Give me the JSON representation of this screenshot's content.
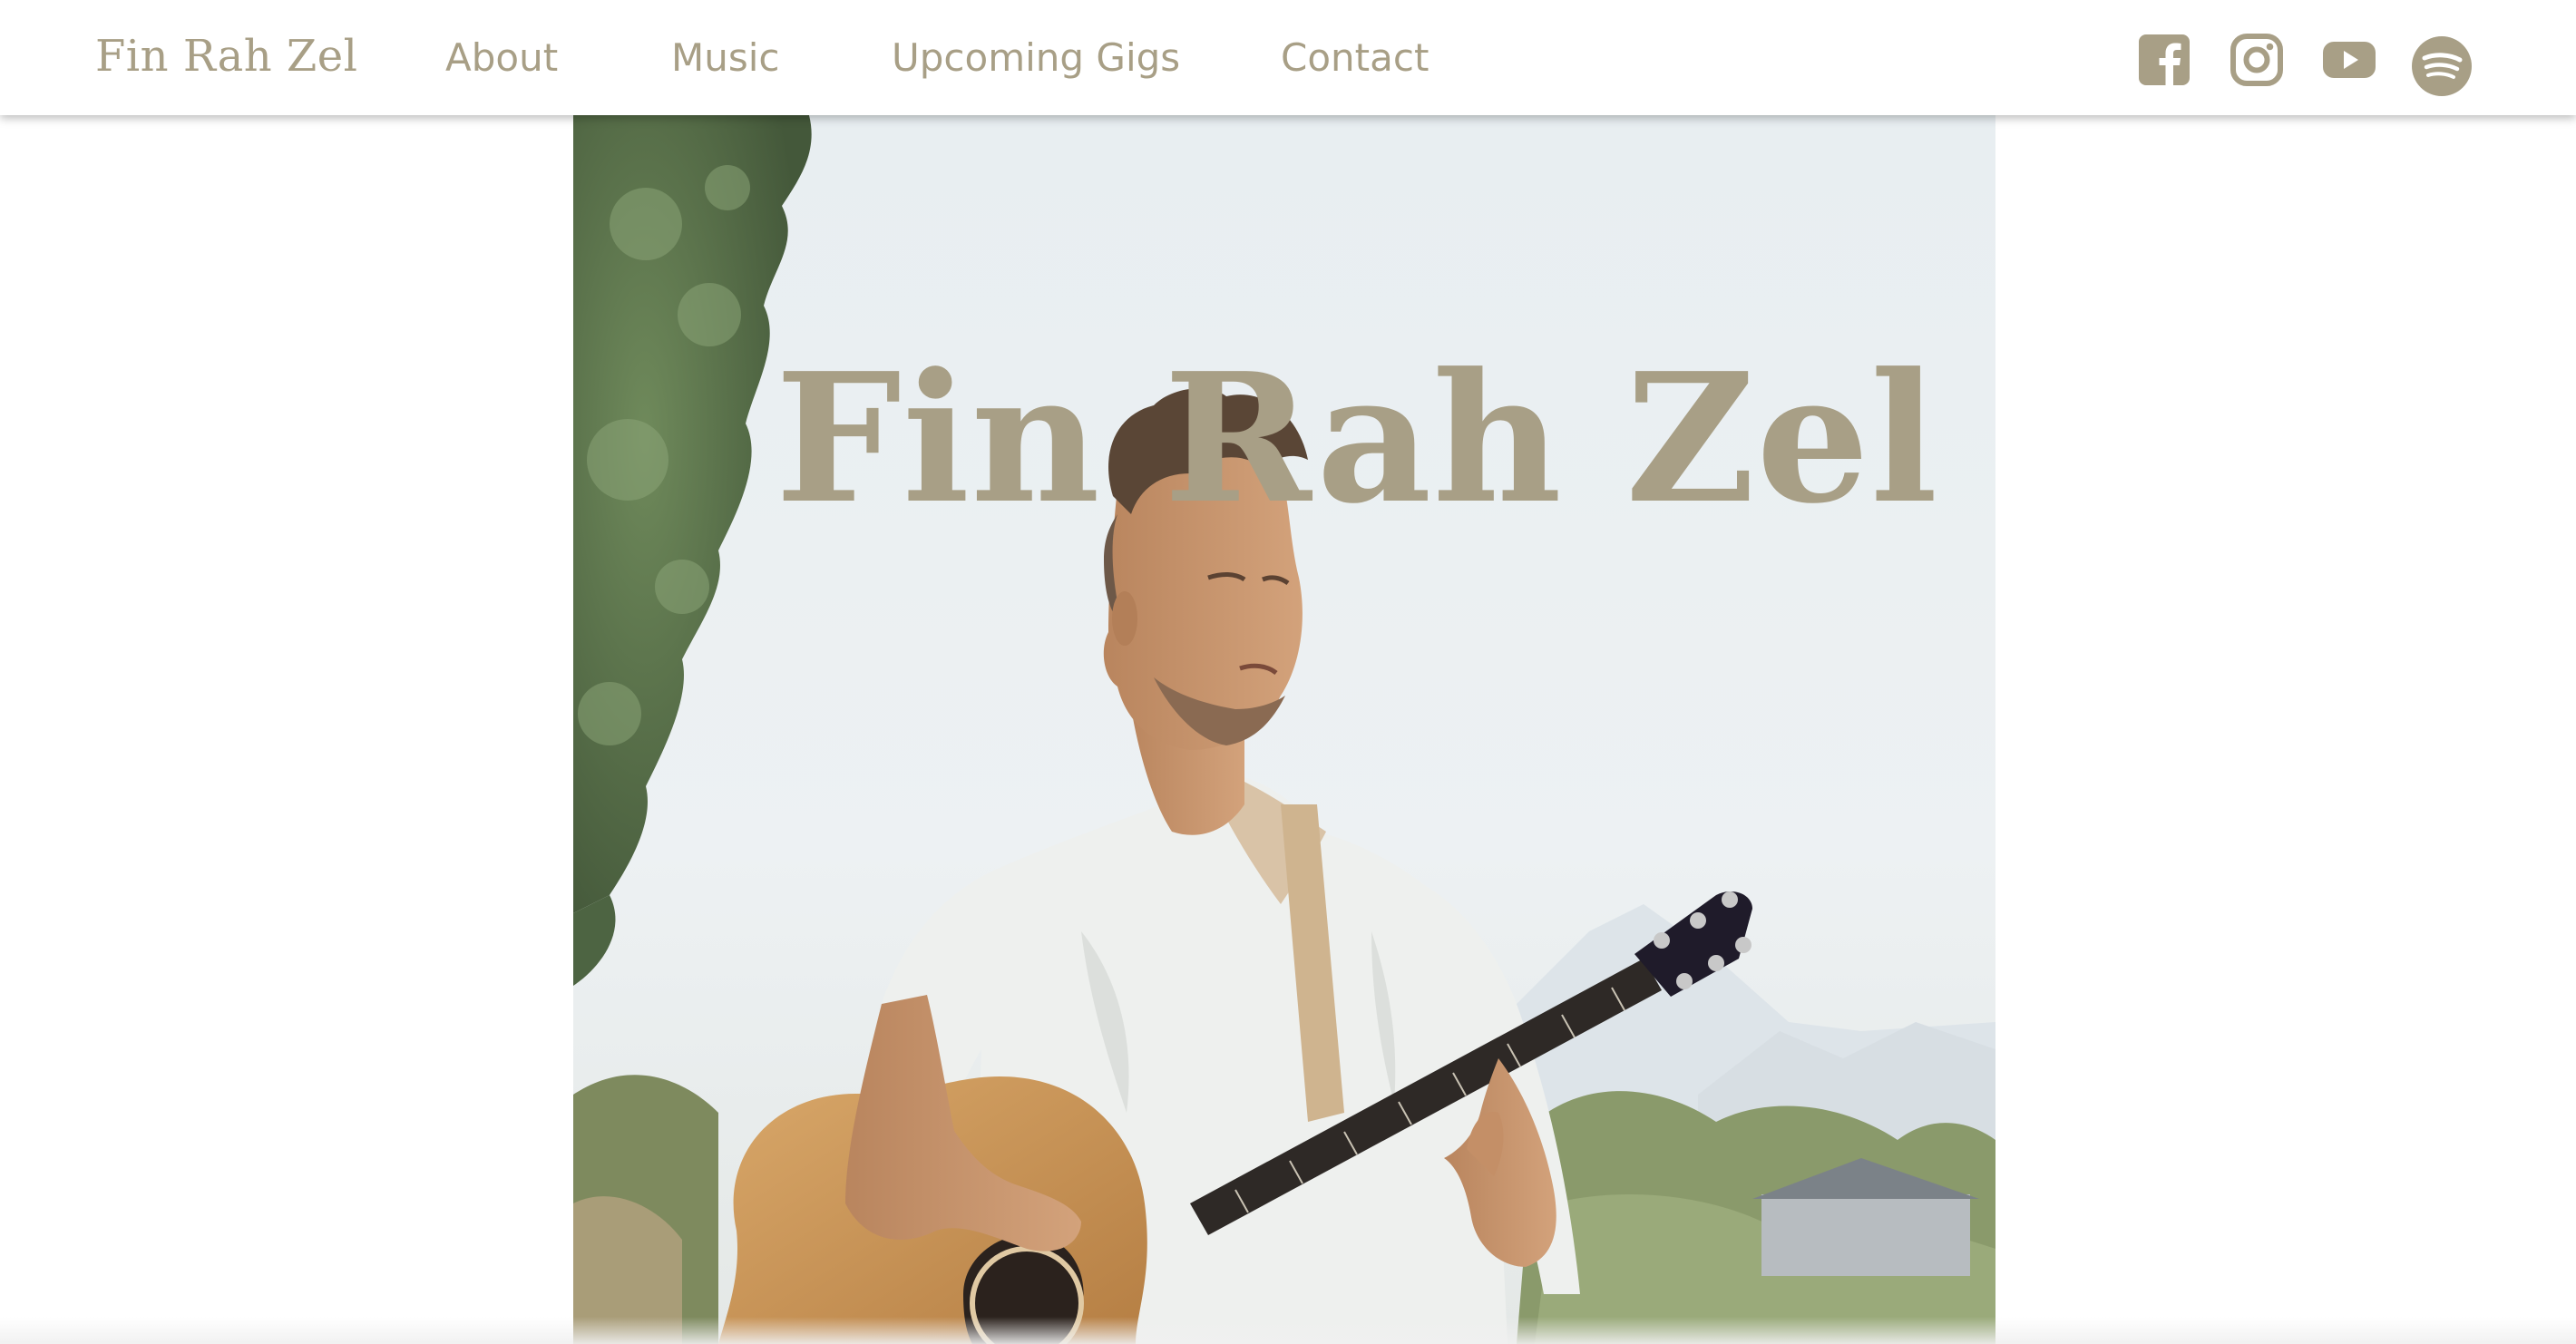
{
  "nav": {
    "brand": "Fin Rah Zel",
    "links": [
      {
        "label": "About"
      },
      {
        "label": "Music"
      },
      {
        "label": "Upcoming Gigs"
      },
      {
        "label": "Contact"
      }
    ],
    "social": [
      {
        "icon": "facebook-icon"
      },
      {
        "icon": "instagram-icon"
      },
      {
        "icon": "youtube-icon"
      },
      {
        "icon": "spotify-icon"
      }
    ]
  },
  "hero": {
    "title": "Fin Rah Zel",
    "image": "musician-playing-acoustic-guitar-outdoors"
  },
  "colors": {
    "accent": "#a89f86",
    "background": "#ffffff",
    "hero_sky": "#edf1f3"
  }
}
